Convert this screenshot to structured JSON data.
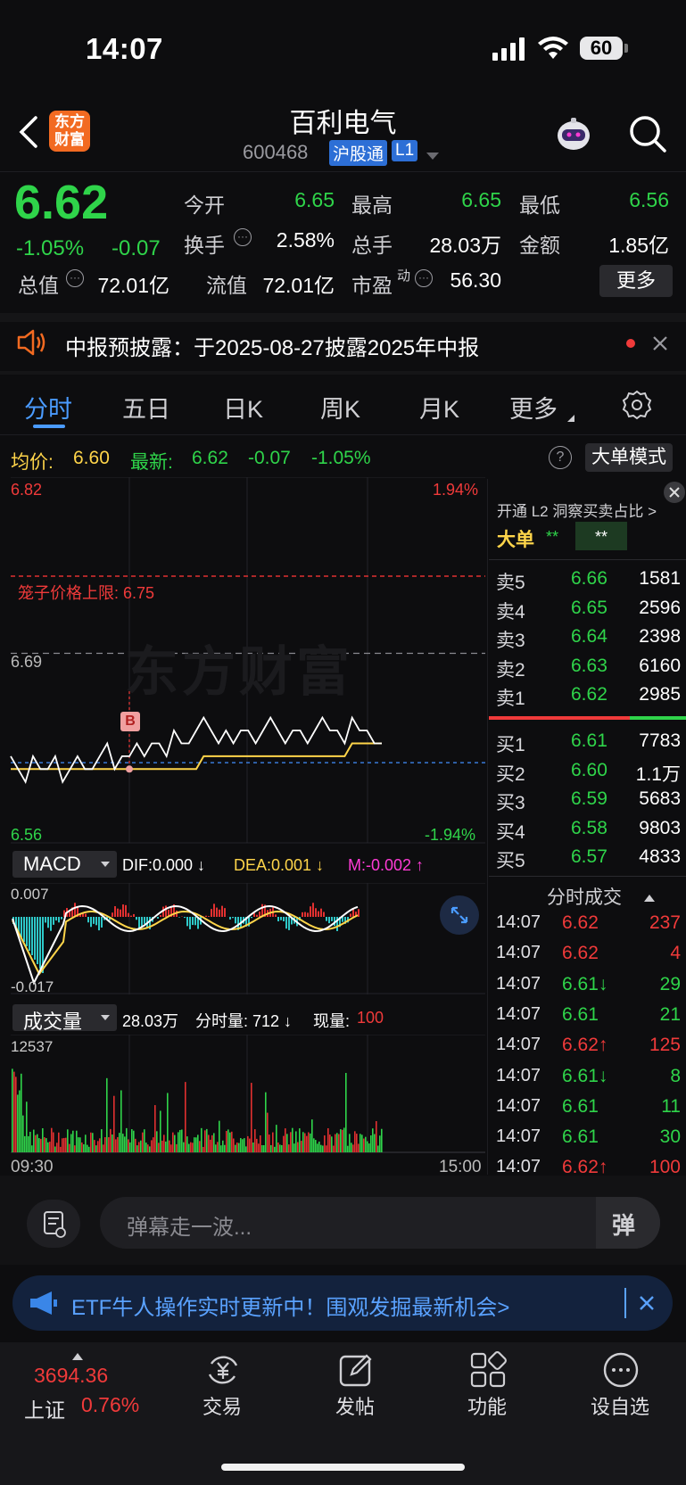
{
  "status": {
    "time": "14:07",
    "battery": "60"
  },
  "header": {
    "logo_text": "东方\n财富",
    "stock_name": "百利电气",
    "stock_code": "600468",
    "market_tag": "沪股通",
    "level_tag": "L1"
  },
  "quote": {
    "price": "6.62",
    "change_pct": "-1.05%",
    "change": "-0.07",
    "rows": [
      [
        {
          "label": "今开",
          "value": "6.65",
          "color": "green"
        },
        {
          "label": "最高",
          "value": "6.65",
          "color": "green"
        },
        {
          "label": "最低",
          "value": "6.56",
          "color": "green"
        }
      ],
      [
        {
          "label": "换手",
          "value": "2.58%",
          "color": "white"
        },
        {
          "label": "总手",
          "value": "28.03万",
          "color": "white"
        },
        {
          "label": "金额",
          "value": "1.85亿",
          "color": "white"
        }
      ],
      [
        {
          "label": "总值",
          "value": "72.01亿",
          "color": "white"
        },
        {
          "label": "流值",
          "value": "72.01亿",
          "color": "white"
        },
        {
          "label": "市盈",
          "value": "56.30",
          "color": "white"
        }
      ]
    ],
    "pe_superscript": "动",
    "more_button": "更多"
  },
  "notice": {
    "text": "中报预披露：于2025-08-27披露2025年中报"
  },
  "tabs": [
    "分时",
    "五日",
    "日K",
    "周K",
    "月K",
    "更多"
  ],
  "active_tab": "分时",
  "info_bar": {
    "avg_label": "均价:",
    "avg_value": "6.60",
    "latest_label": "最新:",
    "latest_value": "6.62",
    "latest_change": "-0.07",
    "latest_pct": "-1.05%",
    "big_order_button": "大单模式"
  },
  "chart_data": {
    "type": "line",
    "title": "",
    "y_top_label": "6.82",
    "y_top_pct": "1.94%",
    "y_bottom_label": "6.56",
    "y_bottom_pct": "-1.94%",
    "ref_price_label": "6.69",
    "limit_label": "笼子价格上限: 6.75",
    "buy_marker": "B",
    "x_start": "09:30",
    "x_end": "15:00",
    "price_series_name": "最新",
    "avg_series_name": "均价",
    "ylim": [
      6.56,
      6.82
    ],
    "price": [
      6.61,
      6.6,
      6.59,
      6.61,
      6.6,
      6.6,
      6.61,
      6.59,
      6.6,
      6.61,
      6.6,
      6.6,
      6.61,
      6.62,
      6.6,
      6.61,
      6.61,
      6.62,
      6.61,
      6.62,
      6.62,
      6.61,
      6.63,
      6.62,
      6.62,
      6.63,
      6.64,
      6.63,
      6.62,
      6.63,
      6.62,
      6.63,
      6.63,
      6.62,
      6.63,
      6.64,
      6.63,
      6.62,
      6.63,
      6.63,
      6.62,
      6.63,
      6.64,
      6.63,
      6.63,
      6.62,
      6.64,
      6.63,
      6.63,
      6.62,
      6.62
    ],
    "avg": [
      6.6,
      6.6,
      6.6,
      6.6,
      6.6,
      6.6,
      6.6,
      6.6,
      6.6,
      6.6,
      6.6,
      6.6,
      6.6,
      6.6,
      6.6,
      6.6,
      6.6,
      6.6,
      6.6,
      6.6,
      6.6,
      6.6,
      6.6,
      6.6,
      6.6,
      6.6,
      6.61,
      6.61,
      6.61,
      6.61,
      6.61,
      6.61,
      6.61,
      6.61,
      6.61,
      6.61,
      6.61,
      6.61,
      6.61,
      6.61,
      6.61,
      6.61,
      6.61,
      6.61,
      6.61,
      6.61,
      6.62,
      6.62,
      6.62,
      6.62,
      6.62
    ]
  },
  "macd": {
    "label": "MACD",
    "dif": "DIF:0.000 ↓",
    "dea": "DEA:0.001 ↓",
    "m": "M:-0.002 ↑",
    "y_top": "0.007",
    "y_bottom": "-0.017"
  },
  "volume": {
    "label": "成交量",
    "total": "28.03万",
    "minute_label": "分时量: 712 ↓",
    "now_label": "现量:",
    "now_value": "100",
    "y_top": "12537"
  },
  "side_panel": {
    "l2_promo": "开通 L2 洞察买卖占比 >",
    "big_label": "大单",
    "big_v1": "**",
    "big_v2": "**",
    "sell": [
      {
        "label": "卖5",
        "price": "6.66",
        "vol": "1581"
      },
      {
        "label": "卖4",
        "price": "6.65",
        "vol": "2596"
      },
      {
        "label": "卖3",
        "price": "6.64",
        "vol": "2398"
      },
      {
        "label": "卖2",
        "price": "6.63",
        "vol": "6160"
      },
      {
        "label": "卖1",
        "price": "6.62",
        "vol": "2985"
      }
    ],
    "buy": [
      {
        "label": "买1",
        "price": "6.61",
        "vol": "7783"
      },
      {
        "label": "买2",
        "price": "6.60",
        "vol": "1.1万"
      },
      {
        "label": "买3",
        "price": "6.59",
        "vol": "5683"
      },
      {
        "label": "买4",
        "price": "6.58",
        "vol": "9803"
      },
      {
        "label": "买5",
        "price": "6.57",
        "vol": "4833"
      }
    ],
    "ticks_title": "分时成交",
    "ticks": [
      {
        "time": "14:07",
        "price": "6.62",
        "vol": "237",
        "color": "red"
      },
      {
        "time": "14:07",
        "price": "6.62",
        "vol": "4",
        "color": "red"
      },
      {
        "time": "14:07",
        "price": "6.61↓",
        "vol": "29",
        "color": "green"
      },
      {
        "time": "14:07",
        "price": "6.61",
        "vol": "21",
        "color": "green"
      },
      {
        "time": "14:07",
        "price": "6.62↑",
        "vol": "125",
        "color": "red"
      },
      {
        "time": "14:07",
        "price": "6.61↓",
        "vol": "8",
        "color": "green"
      },
      {
        "time": "14:07",
        "price": "6.61",
        "vol": "11",
        "color": "green"
      },
      {
        "time": "14:07",
        "price": "6.61",
        "vol": "30",
        "color": "green"
      },
      {
        "time": "14:07",
        "price": "6.62↑",
        "vol": "100",
        "color": "red"
      }
    ]
  },
  "comment_bar": {
    "placeholder": "弹幕走一波...",
    "button": "弹"
  },
  "banner": {
    "text": "ETF牛人操作实时更新中！围观发掘最新机会>"
  },
  "bottom_nav": {
    "index_value": "3694.36",
    "index_name": "上证",
    "index_pct": "0.76%",
    "items": [
      "交易",
      "发帖",
      "功能",
      "设自选"
    ]
  },
  "colors": {
    "up": "#f03a3a",
    "down": "#2fd44a",
    "avg": "#ffd54a",
    "bg": "#0d0d0f"
  }
}
